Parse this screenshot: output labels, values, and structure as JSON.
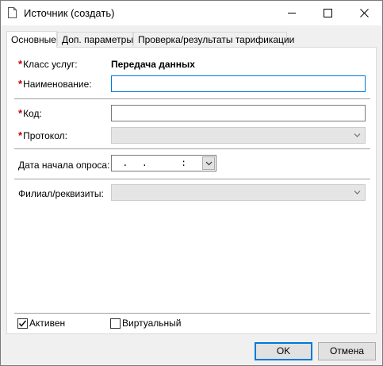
{
  "window": {
    "title": "Источник (создать)"
  },
  "tabs": [
    {
      "label": "Основные",
      "active": true
    },
    {
      "label": "Доп. параметры",
      "active": false
    },
    {
      "label": "Проверка/результаты тарификации",
      "active": false
    }
  ],
  "form": {
    "required_mark": "*",
    "service_class_label": "Класс услуг:",
    "service_class_value": "Передача данных",
    "name_label": "Наименование:",
    "name_value": "",
    "code_label": "Код:",
    "code_value": "",
    "protocol_label": "Протокол:",
    "protocol_value": "",
    "poll_start_label": "Дата начала опроса:",
    "poll_start_mask": " .  .     :  :",
    "branch_label": "Филиал/реквизиты:",
    "branch_value": ""
  },
  "checkboxes": {
    "active_label": "Активен",
    "active_checked": true,
    "virtual_label": "Виртуальный",
    "virtual_checked": false
  },
  "buttons": {
    "ok_label": "OK",
    "cancel_label": "Отмена"
  }
}
